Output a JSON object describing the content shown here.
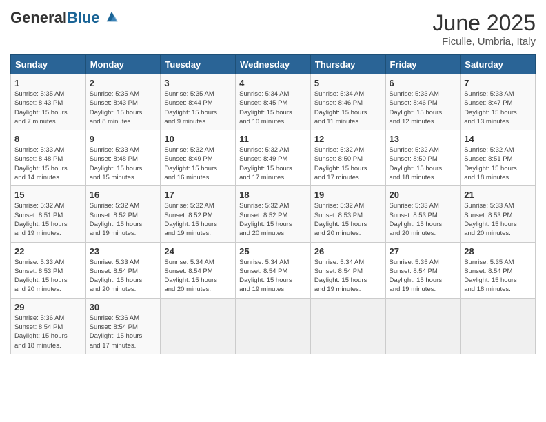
{
  "header": {
    "logo_general": "General",
    "logo_blue": "Blue",
    "month_year": "June 2025",
    "location": "Ficulle, Umbria, Italy"
  },
  "days_of_week": [
    "Sunday",
    "Monday",
    "Tuesday",
    "Wednesday",
    "Thursday",
    "Friday",
    "Saturday"
  ],
  "weeks": [
    [
      {
        "day": "1",
        "info": "Sunrise: 5:35 AM\nSunset: 8:43 PM\nDaylight: 15 hours\nand 7 minutes."
      },
      {
        "day": "2",
        "info": "Sunrise: 5:35 AM\nSunset: 8:43 PM\nDaylight: 15 hours\nand 8 minutes."
      },
      {
        "day": "3",
        "info": "Sunrise: 5:35 AM\nSunset: 8:44 PM\nDaylight: 15 hours\nand 9 minutes."
      },
      {
        "day": "4",
        "info": "Sunrise: 5:34 AM\nSunset: 8:45 PM\nDaylight: 15 hours\nand 10 minutes."
      },
      {
        "day": "5",
        "info": "Sunrise: 5:34 AM\nSunset: 8:46 PM\nDaylight: 15 hours\nand 11 minutes."
      },
      {
        "day": "6",
        "info": "Sunrise: 5:33 AM\nSunset: 8:46 PM\nDaylight: 15 hours\nand 12 minutes."
      },
      {
        "day": "7",
        "info": "Sunrise: 5:33 AM\nSunset: 8:47 PM\nDaylight: 15 hours\nand 13 minutes."
      }
    ],
    [
      {
        "day": "8",
        "info": "Sunrise: 5:33 AM\nSunset: 8:48 PM\nDaylight: 15 hours\nand 14 minutes."
      },
      {
        "day": "9",
        "info": "Sunrise: 5:33 AM\nSunset: 8:48 PM\nDaylight: 15 hours\nand 15 minutes."
      },
      {
        "day": "10",
        "info": "Sunrise: 5:32 AM\nSunset: 8:49 PM\nDaylight: 15 hours\nand 16 minutes."
      },
      {
        "day": "11",
        "info": "Sunrise: 5:32 AM\nSunset: 8:49 PM\nDaylight: 15 hours\nand 17 minutes."
      },
      {
        "day": "12",
        "info": "Sunrise: 5:32 AM\nSunset: 8:50 PM\nDaylight: 15 hours\nand 17 minutes."
      },
      {
        "day": "13",
        "info": "Sunrise: 5:32 AM\nSunset: 8:50 PM\nDaylight: 15 hours\nand 18 minutes."
      },
      {
        "day": "14",
        "info": "Sunrise: 5:32 AM\nSunset: 8:51 PM\nDaylight: 15 hours\nand 18 minutes."
      }
    ],
    [
      {
        "day": "15",
        "info": "Sunrise: 5:32 AM\nSunset: 8:51 PM\nDaylight: 15 hours\nand 19 minutes."
      },
      {
        "day": "16",
        "info": "Sunrise: 5:32 AM\nSunset: 8:52 PM\nDaylight: 15 hours\nand 19 minutes."
      },
      {
        "day": "17",
        "info": "Sunrise: 5:32 AM\nSunset: 8:52 PM\nDaylight: 15 hours\nand 19 minutes."
      },
      {
        "day": "18",
        "info": "Sunrise: 5:32 AM\nSunset: 8:52 PM\nDaylight: 15 hours\nand 20 minutes."
      },
      {
        "day": "19",
        "info": "Sunrise: 5:32 AM\nSunset: 8:53 PM\nDaylight: 15 hours\nand 20 minutes."
      },
      {
        "day": "20",
        "info": "Sunrise: 5:33 AM\nSunset: 8:53 PM\nDaylight: 15 hours\nand 20 minutes."
      },
      {
        "day": "21",
        "info": "Sunrise: 5:33 AM\nSunset: 8:53 PM\nDaylight: 15 hours\nand 20 minutes."
      }
    ],
    [
      {
        "day": "22",
        "info": "Sunrise: 5:33 AM\nSunset: 8:53 PM\nDaylight: 15 hours\nand 20 minutes."
      },
      {
        "day": "23",
        "info": "Sunrise: 5:33 AM\nSunset: 8:54 PM\nDaylight: 15 hours\nand 20 minutes."
      },
      {
        "day": "24",
        "info": "Sunrise: 5:34 AM\nSunset: 8:54 PM\nDaylight: 15 hours\nand 20 minutes."
      },
      {
        "day": "25",
        "info": "Sunrise: 5:34 AM\nSunset: 8:54 PM\nDaylight: 15 hours\nand 19 minutes."
      },
      {
        "day": "26",
        "info": "Sunrise: 5:34 AM\nSunset: 8:54 PM\nDaylight: 15 hours\nand 19 minutes."
      },
      {
        "day": "27",
        "info": "Sunrise: 5:35 AM\nSunset: 8:54 PM\nDaylight: 15 hours\nand 19 minutes."
      },
      {
        "day": "28",
        "info": "Sunrise: 5:35 AM\nSunset: 8:54 PM\nDaylight: 15 hours\nand 18 minutes."
      }
    ],
    [
      {
        "day": "29",
        "info": "Sunrise: 5:36 AM\nSunset: 8:54 PM\nDaylight: 15 hours\nand 18 minutes."
      },
      {
        "day": "30",
        "info": "Sunrise: 5:36 AM\nSunset: 8:54 PM\nDaylight: 15 hours\nand 17 minutes."
      },
      {
        "day": "",
        "info": ""
      },
      {
        "day": "",
        "info": ""
      },
      {
        "day": "",
        "info": ""
      },
      {
        "day": "",
        "info": ""
      },
      {
        "day": "",
        "info": ""
      }
    ]
  ]
}
